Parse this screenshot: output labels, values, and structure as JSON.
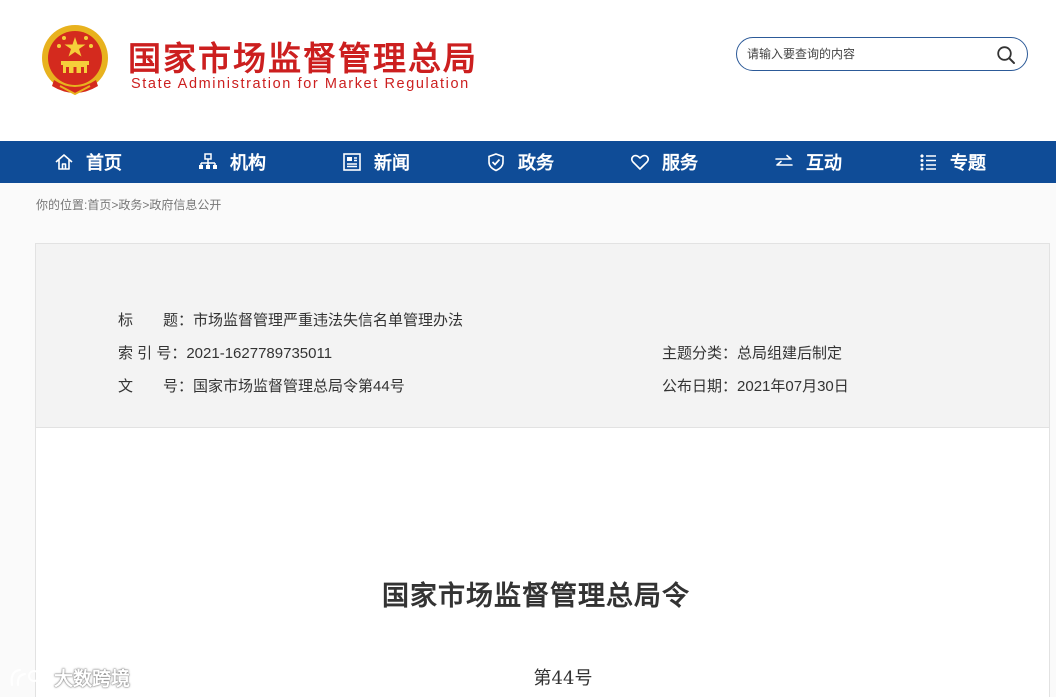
{
  "header": {
    "site_title": "国家市场监督管理总局",
    "site_subtitle": "State Administration for Market Regulation",
    "emblem_icon": "national-emblem-icon",
    "search": {
      "placeholder": "请输入要查询的内容",
      "icon": "search-icon"
    }
  },
  "nav": {
    "items": [
      {
        "label": "首页",
        "icon": "home-icon"
      },
      {
        "label": "机构",
        "icon": "org-chart-icon"
      },
      {
        "label": "新闻",
        "icon": "newspaper-icon"
      },
      {
        "label": "政务",
        "icon": "shield-icon"
      },
      {
        "label": "服务",
        "icon": "heart-icon"
      },
      {
        "label": "互动",
        "icon": "swap-arrows-icon"
      },
      {
        "label": "专题",
        "icon": "topic-list-icon"
      }
    ]
  },
  "breadcrumb": "你的位置:首页>政务>政府信息公开",
  "meta": {
    "title_label": "标　　题：",
    "title_value": "市场监督管理严重违法失信名单管理办法",
    "index_label": "索 引 号：",
    "index_value": "2021-1627789735011",
    "category_label": "主题分类：",
    "category_value": "总局组建后制定",
    "docno_label": "文　　号：",
    "docno_value": "国家市场监督管理总局令第44号",
    "date_label": "公布日期：",
    "date_value": "2021年07月30日"
  },
  "document": {
    "heading": "国家市场监督管理总局令",
    "number": "第44号"
  },
  "watermark": {
    "text": "大数跨境"
  },
  "colors": {
    "brand_red": "#cc1f1f",
    "nav_blue": "#0f4c97",
    "search_border": "#2c5a98"
  }
}
